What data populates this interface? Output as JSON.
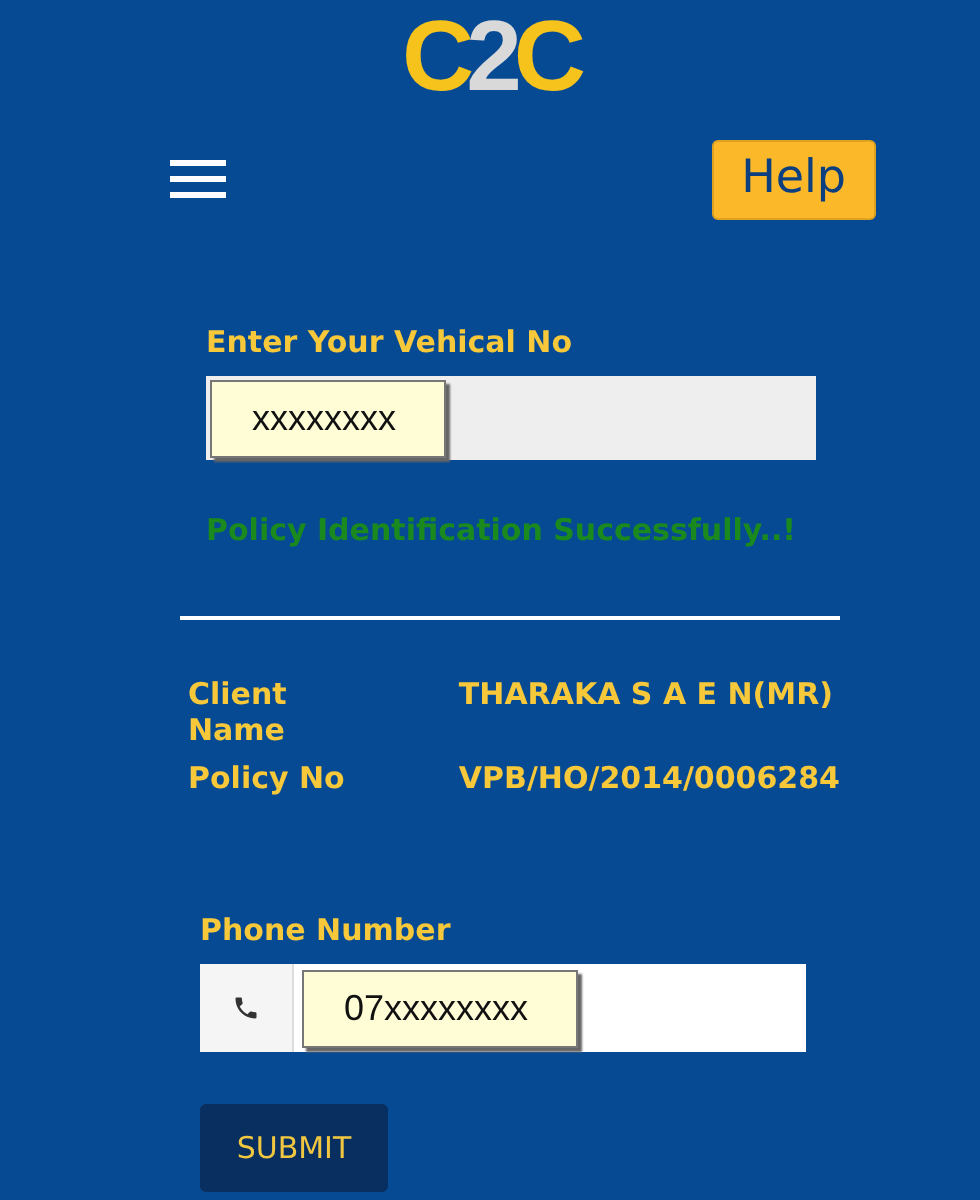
{
  "logo": [
    {
      "text": "C",
      "color": "#f6c21c"
    },
    {
      "text": "2",
      "color": "#d9d9d9"
    },
    {
      "text": "C",
      "color": "#f6c21c"
    }
  ],
  "help_button": "Help",
  "vehicle": {
    "label": "Enter Your Vehical No",
    "value": "xxxxxxxx"
  },
  "message": "Policy Identification Successfully..!",
  "details": [
    {
      "label": "Client Name",
      "value": "THARAKA S A E N(MR)"
    },
    {
      "label": "Policy No",
      "value": "VPB/HO/2014/0006284"
    }
  ],
  "phone": {
    "label": "Phone Number",
    "value": "07xxxxxxxx"
  },
  "submit_button": "SUBMIT"
}
